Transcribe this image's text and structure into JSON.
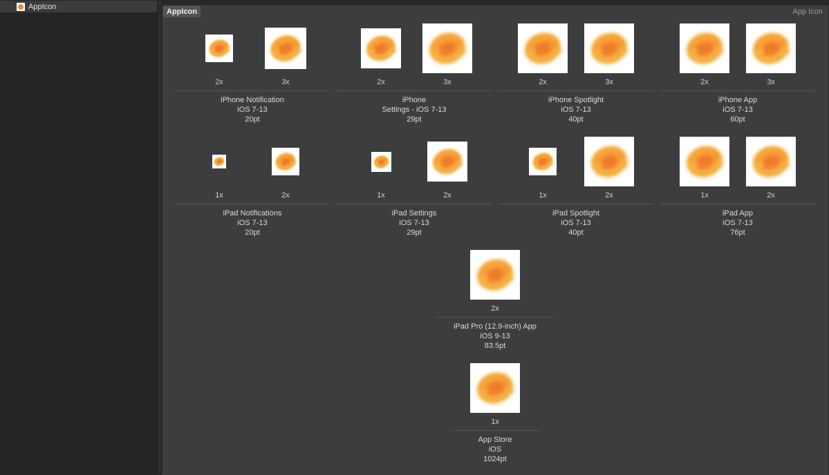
{
  "sidebar": {
    "item_label": "AppIcon",
    "item_icon": "app-icon-thumbnail"
  },
  "header": {
    "title": "AppIcon",
    "kind": "App Icon"
  },
  "icon_groups": [
    {
      "id": "iphone-notification",
      "name": "iPhone Notification",
      "ios": "iOS 7-13",
      "size": "20pt",
      "slots": [
        {
          "scale": "2x"
        },
        {
          "scale": "3x"
        }
      ]
    },
    {
      "id": "iphone-settings",
      "name": "iPhone\nSettings - iOS 7-13",
      "ios": "",
      "size": "29pt",
      "slots": [
        {
          "scale": "2x"
        },
        {
          "scale": "3x"
        }
      ]
    },
    {
      "id": "iphone-spotlight",
      "name": "iPhone Spotlight",
      "ios": "iOS 7-13",
      "size": "40pt",
      "slots": [
        {
          "scale": "2x"
        },
        {
          "scale": "3x"
        }
      ]
    },
    {
      "id": "iphone-app",
      "name": "iPhone App",
      "ios": "iOS 7-13",
      "size": "60pt",
      "slots": [
        {
          "scale": "2x"
        },
        {
          "scale": "3x"
        }
      ]
    },
    {
      "id": "ipad-notifications",
      "name": "iPad Notifications",
      "ios": "iOS 7-13",
      "size": "20pt",
      "slots": [
        {
          "scale": "1x"
        },
        {
          "scale": "2x"
        }
      ]
    },
    {
      "id": "ipad-settings",
      "name": "iPad Settings",
      "ios": "iOS 7-13",
      "size": "29pt",
      "slots": [
        {
          "scale": "1x"
        },
        {
          "scale": "2x"
        }
      ]
    },
    {
      "id": "ipad-spotlight",
      "name": "iPad Spotlight",
      "ios": "iOS 7-13",
      "size": "40pt",
      "slots": [
        {
          "scale": "1x"
        },
        {
          "scale": "2x"
        }
      ]
    },
    {
      "id": "ipad-app",
      "name": "iPad App",
      "ios": "iOS 7-13",
      "size": "76pt",
      "slots": [
        {
          "scale": "1x"
        },
        {
          "scale": "2x"
        }
      ]
    },
    {
      "id": "ipad-pro-app",
      "name": "iPad Pro (12.9-inch) App",
      "ios": "iOS 9-13",
      "size": "83.5pt",
      "slots": [
        {
          "scale": "2x"
        }
      ]
    },
    {
      "id": "app-store",
      "name": "App Store",
      "ios": "iOS",
      "size": "1024pt",
      "slots": [
        {
          "scale": "1x"
        }
      ]
    }
  ],
  "icon_image": "orange-sun-blur",
  "colors": {
    "icon_orange": "#f28a2e",
    "icon_yellow": "#f8c14a",
    "panel": "#3d3d3d"
  }
}
